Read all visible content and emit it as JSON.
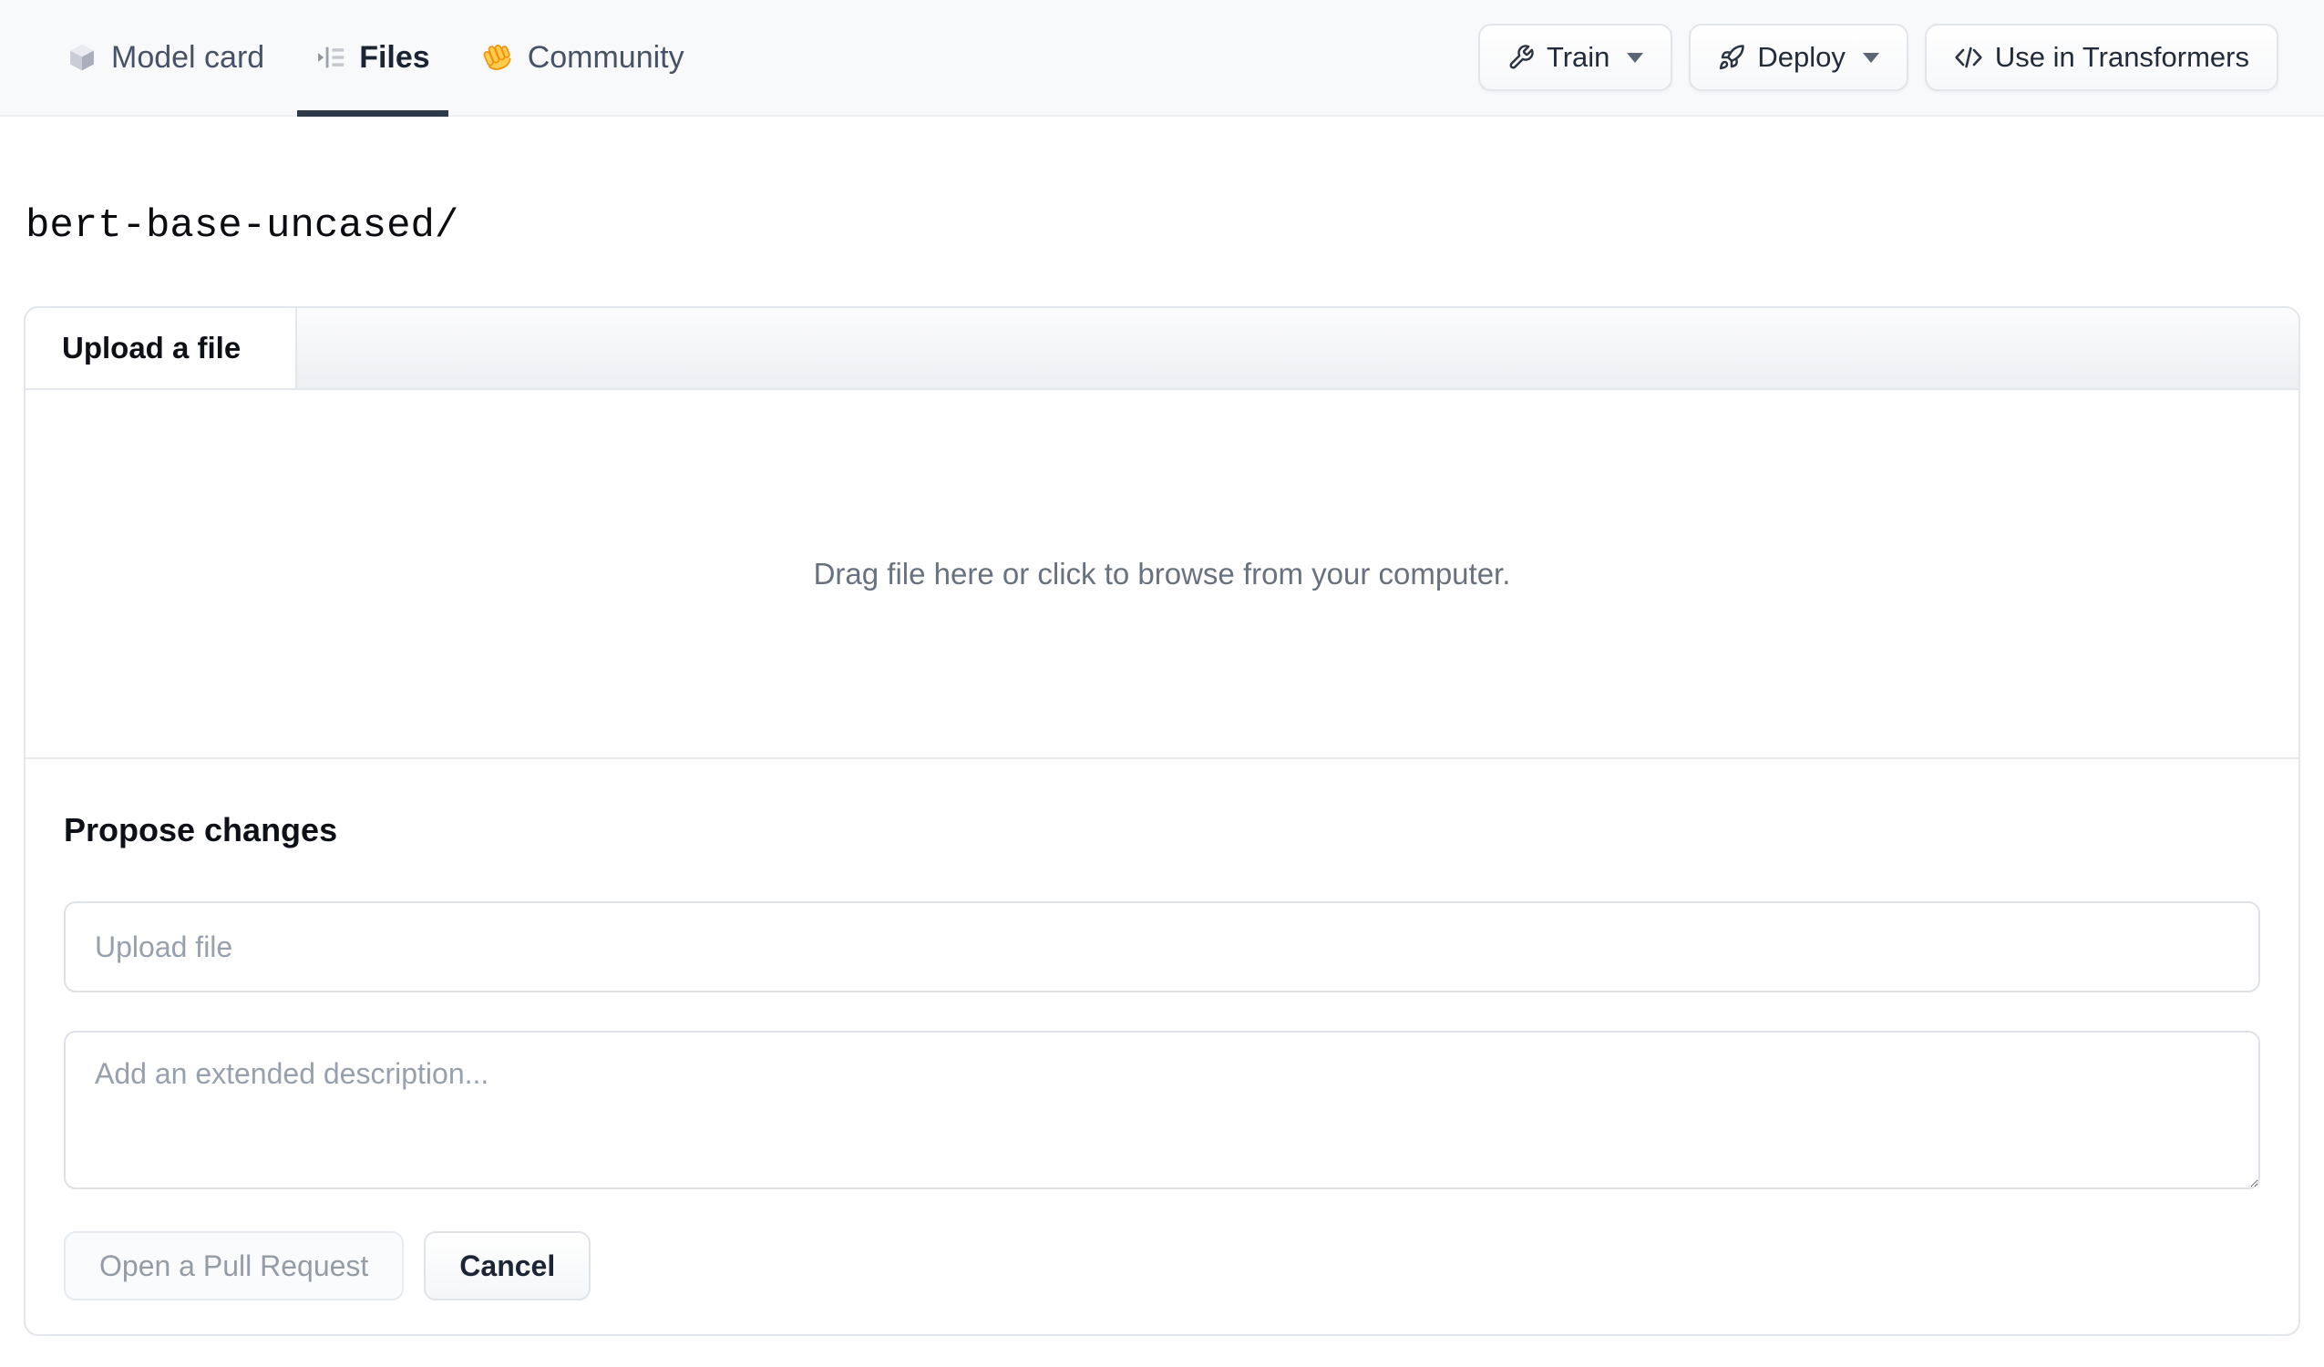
{
  "nav": {
    "tabs": [
      {
        "label": "Model card",
        "icon": "cube-icon",
        "active": false
      },
      {
        "label": "Files",
        "icon": "list-tree-icon",
        "active": true
      },
      {
        "label": "Community",
        "icon": "waving-hand-icon",
        "active": false
      }
    ],
    "actions": [
      {
        "label": "Train",
        "icon": "wrench-icon",
        "dropdown": true
      },
      {
        "label": "Deploy",
        "icon": "rocket-icon",
        "dropdown": true
      },
      {
        "label": "Use in Transformers",
        "icon": "code-icon",
        "dropdown": false
      }
    ]
  },
  "breadcrumb": {
    "path": "bert-base-uncased/"
  },
  "upload_card": {
    "tab_label": "Upload a file",
    "dropzone_text": "Drag file here or click to browse from your computer.",
    "propose": {
      "heading": "Propose changes",
      "filename_placeholder": "Upload file",
      "description_placeholder": "Add an extended description...",
      "submit_label": "Open a Pull Request",
      "cancel_label": "Cancel"
    }
  },
  "colors": {
    "header_bg": "#f8f9fb",
    "active_tab_underline": "#2e3949",
    "card_border": "#e3e6ea",
    "placeholder_text": "#97a0ad",
    "dropzone_text": "#68727f",
    "disabled_button_text": "#949ca6",
    "dark_text": "#0d1117",
    "hand_emoji_yellow": "#ffcc4d",
    "hand_emoji_orange": "#f4900c"
  }
}
